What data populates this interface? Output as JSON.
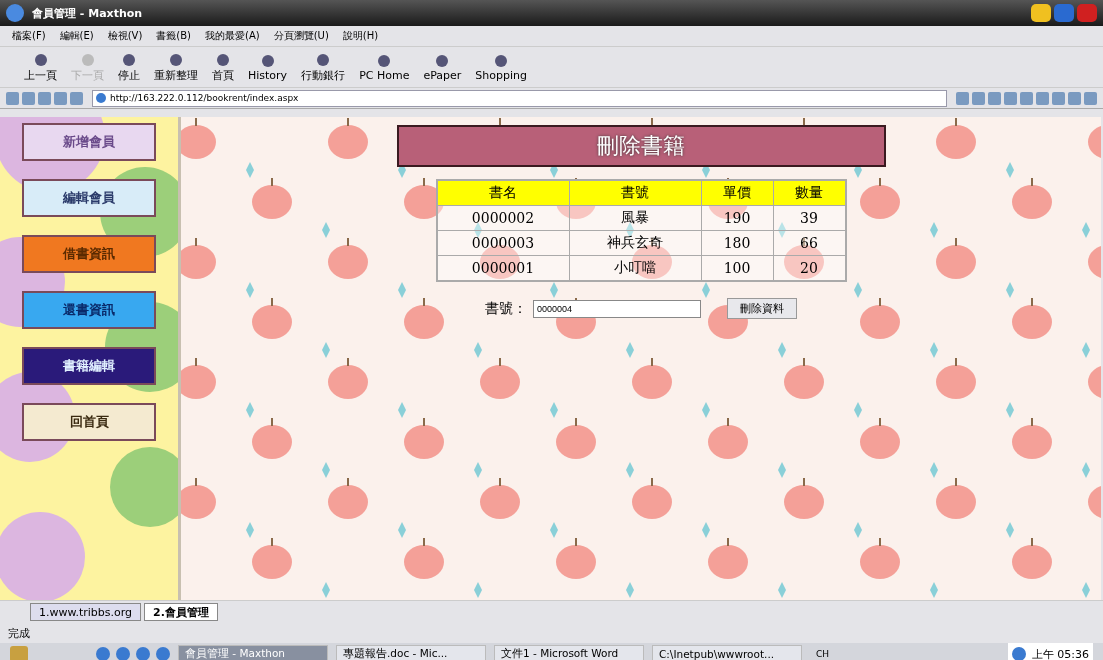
{
  "window": {
    "title": "會員管理 - Maxthon"
  },
  "menu": [
    "檔案(F)",
    "編輯(E)",
    "檢視(V)",
    "書籤(B)",
    "我的最愛(A)",
    "分頁瀏覽(U)",
    "說明(H)"
  ],
  "toolbar": [
    {
      "label": "上一頁",
      "disabled": false
    },
    {
      "label": "下一頁",
      "disabled": true
    },
    {
      "label": "停止",
      "disabled": false
    },
    {
      "label": "重新整理",
      "disabled": false
    },
    {
      "label": "首頁",
      "disabled": false
    },
    {
      "label": "History",
      "disabled": false
    },
    {
      "label": "行動銀行",
      "disabled": false
    },
    {
      "label": "PC Home",
      "disabled": false
    },
    {
      "label": "ePaper",
      "disabled": false
    },
    {
      "label": "Shopping",
      "disabled": false
    }
  ],
  "address": "http://163.222.0.112/bookrent/index.aspx",
  "sidebar": {
    "items": [
      {
        "label": "新增會員",
        "kind": "flower"
      },
      {
        "label": "編輯會員",
        "kind": "cloud"
      },
      {
        "label": "借書資訊",
        "kind": "pencil"
      },
      {
        "label": "還書資訊",
        "kind": "crayon"
      },
      {
        "label": "書籍編輯",
        "kind": "ribbon"
      },
      {
        "label": "回首頁",
        "kind": "bone"
      }
    ]
  },
  "page": {
    "heading": "刪除書籍",
    "table": {
      "columns": [
        "書名",
        "書號",
        "單價",
        "數量"
      ],
      "rows": [
        [
          "0000002",
          "風暴",
          "190",
          "39"
        ],
        [
          "0000003",
          "神兵玄奇",
          "180",
          "66"
        ],
        [
          "0000001",
          "小叮噹",
          "100",
          "20"
        ]
      ]
    },
    "field": {
      "label": "書號：",
      "value": "0000004"
    },
    "button": "刪除資料"
  },
  "tabs": [
    {
      "label": "1.www.tribbs.org",
      "selected": false
    },
    {
      "label": "2.會員管理",
      "selected": true
    }
  ],
  "status_bar": "完成",
  "taskbar": {
    "tasks": [
      {
        "label": "會員管理 - Maxthon",
        "selected": true
      },
      {
        "label": "專題報告.doc - Mic...",
        "selected": false
      },
      {
        "label": "文件1 - Microsoft Word",
        "selected": false
      },
      {
        "label": "C:\\Inetpub\\wwwroot...",
        "selected": false
      }
    ],
    "language": "CH",
    "clock": "上午 05:36"
  }
}
